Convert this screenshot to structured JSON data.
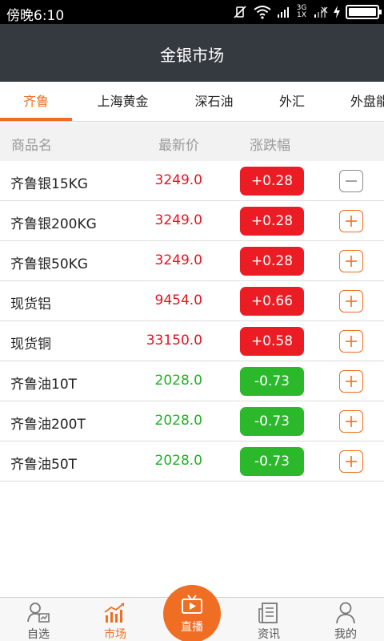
{
  "status_bar": {
    "time": "傍晚6:10",
    "network_label": "3G 1X"
  },
  "header": {
    "title": "金银市场"
  },
  "tabs": [
    {
      "label": "齐鲁",
      "active": true
    },
    {
      "label": "上海黄金",
      "active": false
    },
    {
      "label": "深石油",
      "active": false
    },
    {
      "label": "外汇",
      "active": false
    },
    {
      "label": "外盘能",
      "active": false
    }
  ],
  "columns": {
    "name": "商品名",
    "price": "最新价",
    "change": "涨跌幅"
  },
  "rows": [
    {
      "name": "齐鲁银15KG",
      "price": "3249.0",
      "change": "+0.28",
      "direction": "up",
      "action": "remove"
    },
    {
      "name": "齐鲁银200KG",
      "price": "3249.0",
      "change": "+0.28",
      "direction": "up",
      "action": "add"
    },
    {
      "name": "齐鲁银50KG",
      "price": "3249.0",
      "change": "+0.28",
      "direction": "up",
      "action": "add"
    },
    {
      "name": "现货铝",
      "price": "9454.0",
      "change": "+0.66",
      "direction": "up",
      "action": "add"
    },
    {
      "name": "现货铜",
      "price": "33150.0",
      "change": "+0.58",
      "direction": "up",
      "action": "add"
    },
    {
      "name": "齐鲁油10T",
      "price": "2028.0",
      "change": "-0.73",
      "direction": "down",
      "action": "add"
    },
    {
      "name": "齐鲁油200T",
      "price": "2028.0",
      "change": "-0.73",
      "direction": "down",
      "action": "add"
    },
    {
      "name": "齐鲁油50T",
      "price": "2028.0",
      "change": "-0.73",
      "direction": "down",
      "action": "add"
    }
  ],
  "bottom_nav": {
    "watchlist": {
      "label": "自选",
      "icon": "person-chart-icon"
    },
    "market": {
      "label": "市场",
      "icon": "bar-chart-icon",
      "active": true
    },
    "live": {
      "label": "直播",
      "icon": "tv-icon"
    },
    "news": {
      "label": "资讯",
      "icon": "newspaper-icon"
    },
    "mine": {
      "label": "我的",
      "icon": "user-icon"
    }
  },
  "colors": {
    "accent": "#f06e23",
    "header_bg": "#353a40",
    "up": "#ec1c24",
    "down": "#2bb82b"
  }
}
